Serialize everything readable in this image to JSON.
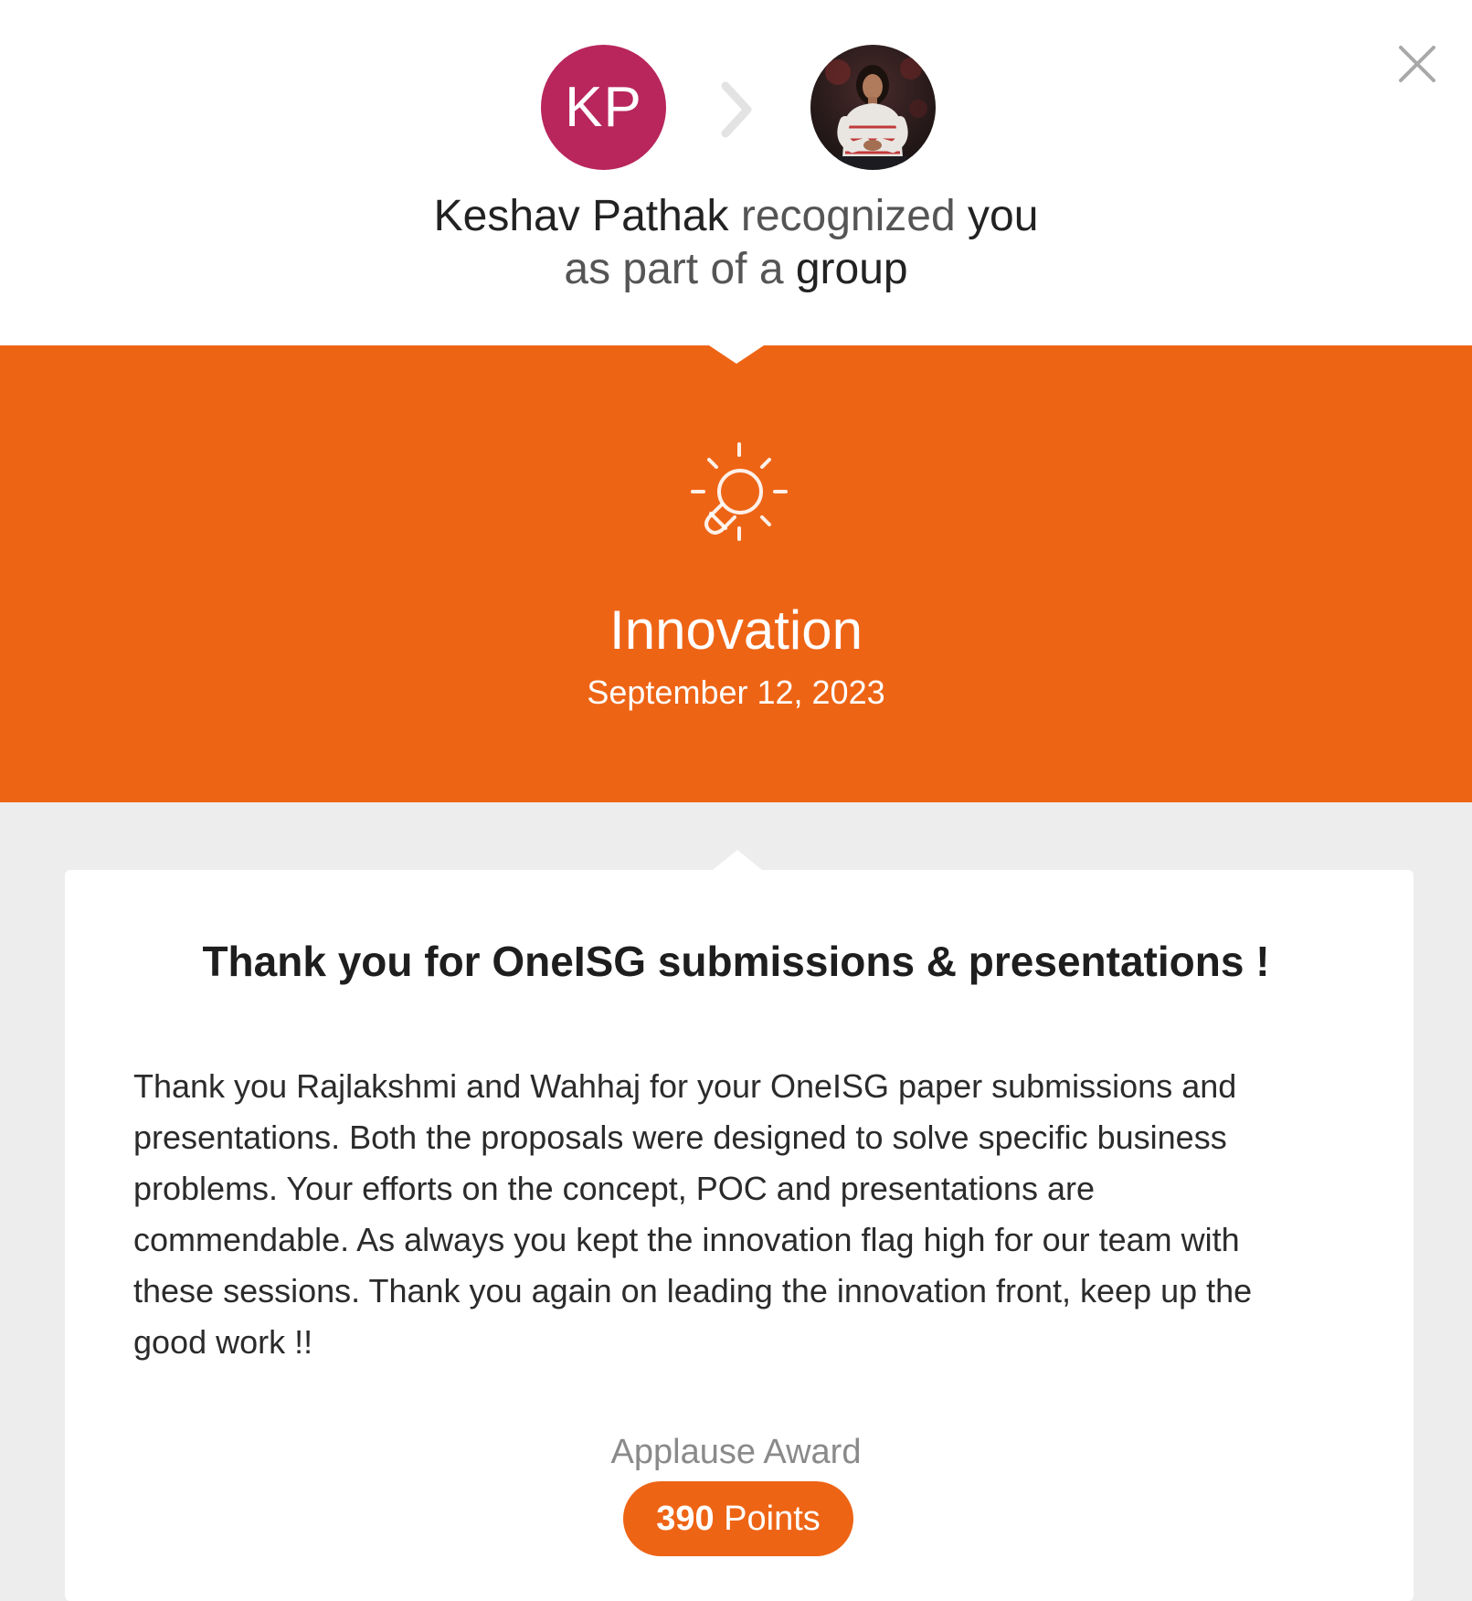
{
  "header": {
    "giver_initials": "KP",
    "giver_name": "Keshav Pathak",
    "verb": "recognized",
    "recipient": "you",
    "line2_prefix": "as part of a",
    "line2_suffix": "group"
  },
  "banner": {
    "value_name": "Innovation",
    "date": "September 12, 2023",
    "accent_color": "#ee6415"
  },
  "card": {
    "title": "Thank you for OneISG submissions & presentations !",
    "message": "Thank you Rajlakshmi and Wahhaj for your OneISG paper submissions and presentations. Both the proposals were designed to solve specific business problems. Your efforts on the concept, POC and presentations are commendable. As always you kept the innovation flag high for our team with these sessions. Thank you again on leading the innovation front, keep up the good work !!",
    "award_label": "Applause Award",
    "points_value": "390",
    "points_unit": "Points"
  },
  "icons": {
    "close": "close-icon",
    "arrow": "chevron-right-icon",
    "value": "lightbulb-icon"
  },
  "colors": {
    "avatar_bg": "#b8265c",
    "banner_bg": "#ee6415",
    "page_bg": "#ededed"
  }
}
